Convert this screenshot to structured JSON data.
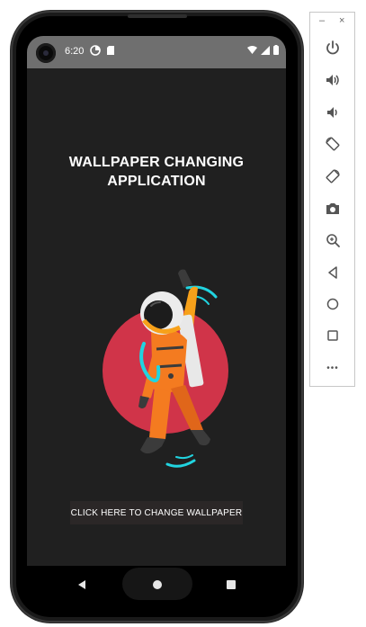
{
  "status_bar": {
    "time": "6:20"
  },
  "app": {
    "title_line1": "WALLPAPER CHANGING",
    "title_line2": "APPLICATION",
    "button_label": "CLICK HERE TO CHANGE WALLPAPER"
  },
  "colors": {
    "screen_bg": "#202020",
    "status_bar_bg": "#6f6f6f",
    "circle": "#d03449",
    "suit": "#f47b20",
    "accent_cyan": "#21d4e0",
    "button_bg": "#2b2727"
  },
  "nav": {
    "back_icon": "back-triangle-icon",
    "home_icon": "home-circle-icon",
    "recents_icon": "recents-square-icon"
  },
  "emulator_panel": {
    "minimize": "–",
    "close": "×",
    "more": "•••",
    "icons": [
      "power-icon",
      "volume-up-icon",
      "volume-down-icon",
      "rotate-left-icon",
      "rotate-right-icon",
      "camera-icon",
      "zoom-icon",
      "back-icon",
      "home-icon",
      "overview-icon",
      "more-icon"
    ]
  }
}
